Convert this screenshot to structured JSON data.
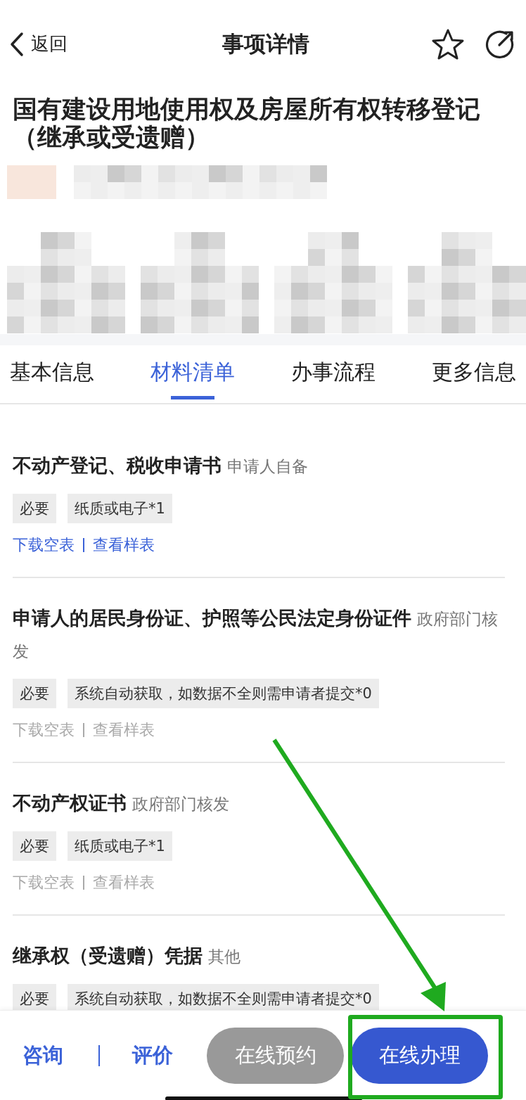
{
  "header": {
    "back": "返回",
    "title": "事项详情"
  },
  "item_title": "国有建设用地使用权及房屋所有权转移登记（继承或受遗赠）",
  "tabs": [
    {
      "label": "基本信息",
      "selected": false
    },
    {
      "label": "材料清单",
      "selected": true
    },
    {
      "label": "办事流程",
      "selected": false
    },
    {
      "label": "更多信息",
      "selected": false
    }
  ],
  "materials": [
    {
      "name": "不动产登记、税收申请书",
      "source": "申请人自备",
      "tags": [
        "必要",
        "纸质或电子*1"
      ],
      "links": [
        "下载空表",
        "查看样表"
      ],
      "links_disabled": false
    },
    {
      "name": "申请人的居民身份证、护照等公民法定身份证件",
      "source": "政府部门核发",
      "tags": [
        "必要",
        "系统自动获取，如数据不全则需申请者提交*0"
      ],
      "links": [
        "下载空表",
        "查看样表"
      ],
      "links_disabled": true
    },
    {
      "name": "不动产权证书",
      "source": "政府部门核发",
      "tags": [
        "必要",
        "纸质或电子*1"
      ],
      "links": [
        "下载空表",
        "查看样表"
      ],
      "links_disabled": true
    },
    {
      "name": "继承权（受遗赠）凭据",
      "source": "其他",
      "tags": [
        "必要",
        "系统自动获取，如数据不全则需申请者提交*0"
      ]
    }
  ],
  "bottom_bar": {
    "links": [
      "咨询",
      "评价"
    ],
    "buttons": [
      {
        "label": "在线预约",
        "kind": "secondary"
      },
      {
        "label": "在线办理",
        "kind": "primary"
      }
    ]
  }
}
